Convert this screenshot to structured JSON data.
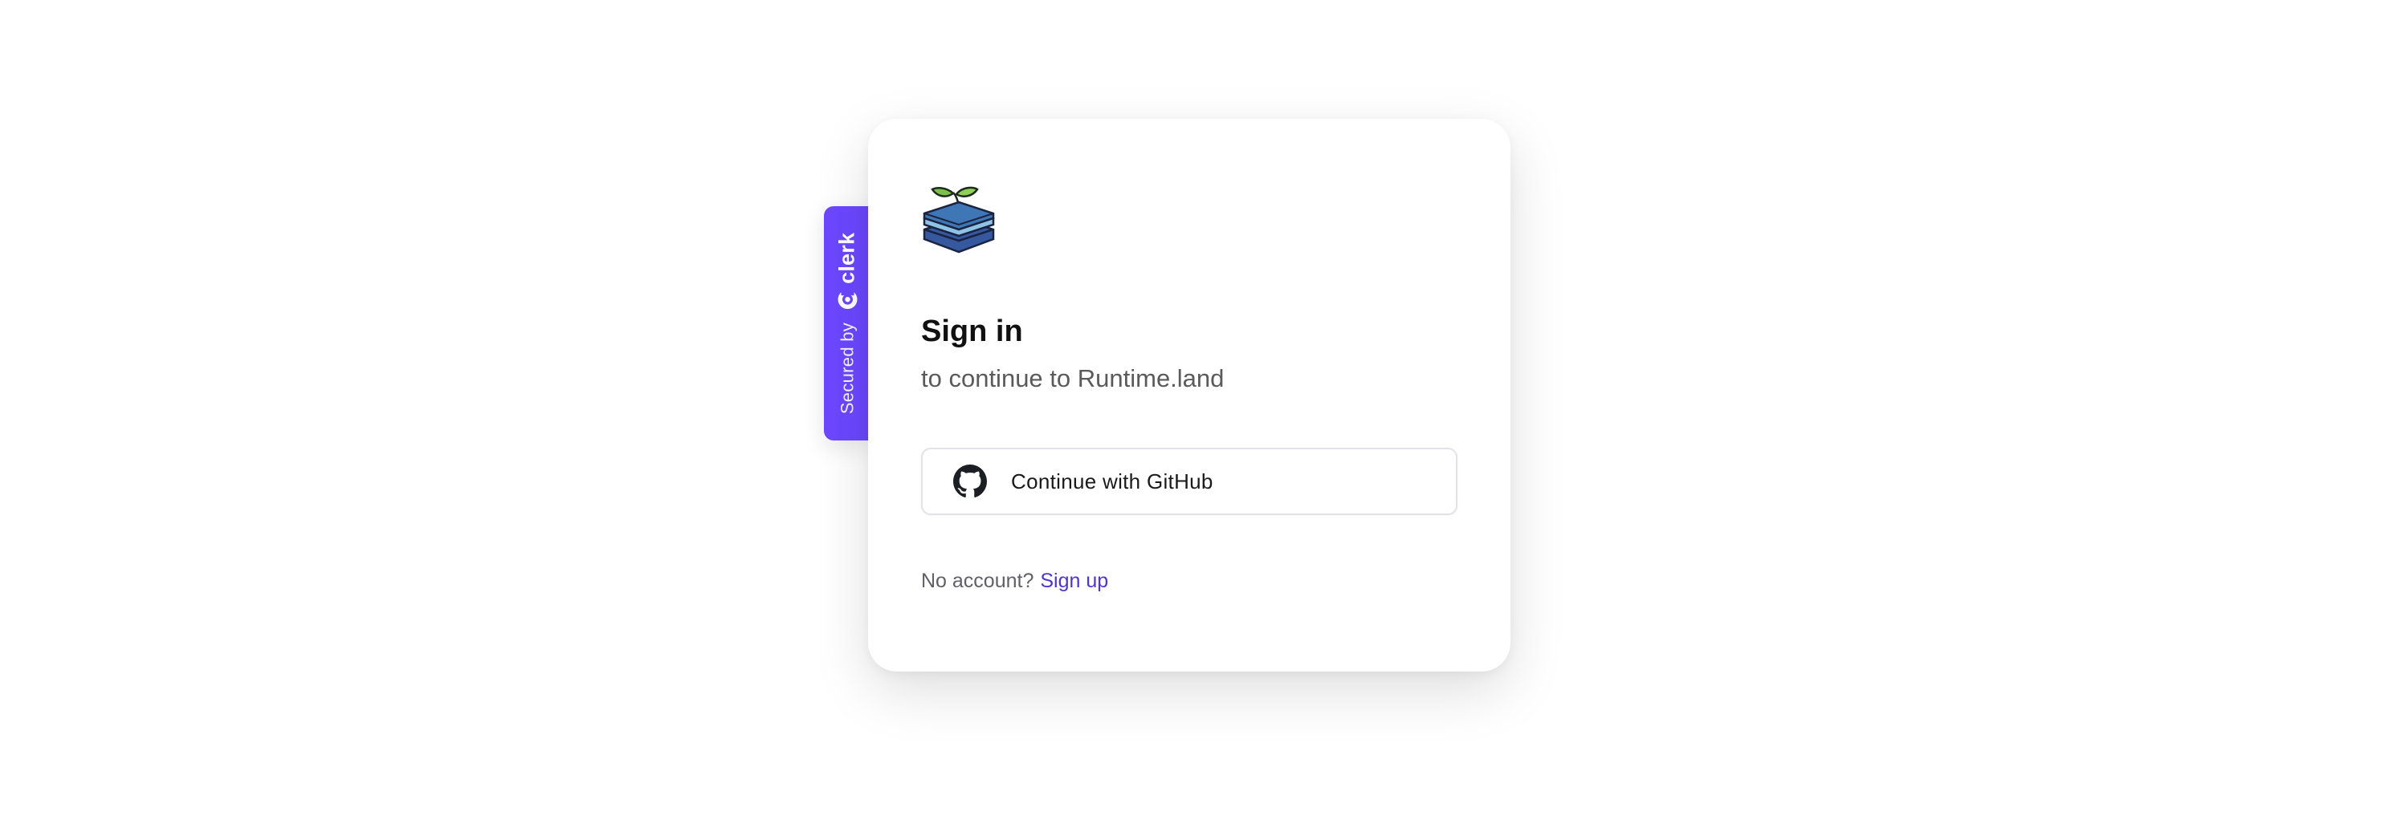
{
  "badge": {
    "secured_text": "Secured by",
    "brand": "clerk",
    "icon": "clerk-logo-icon",
    "color": "#6c47ff"
  },
  "app": {
    "logo_icon": "runtime-land-logo-icon"
  },
  "signin": {
    "title": "Sign in",
    "subtitle": "to continue to Runtime.land",
    "github_button": {
      "label": "Continue with GitHub",
      "icon": "github-icon"
    },
    "footer": {
      "text": "No account?",
      "link": "Sign up",
      "link_color": "#4f35c9"
    }
  }
}
